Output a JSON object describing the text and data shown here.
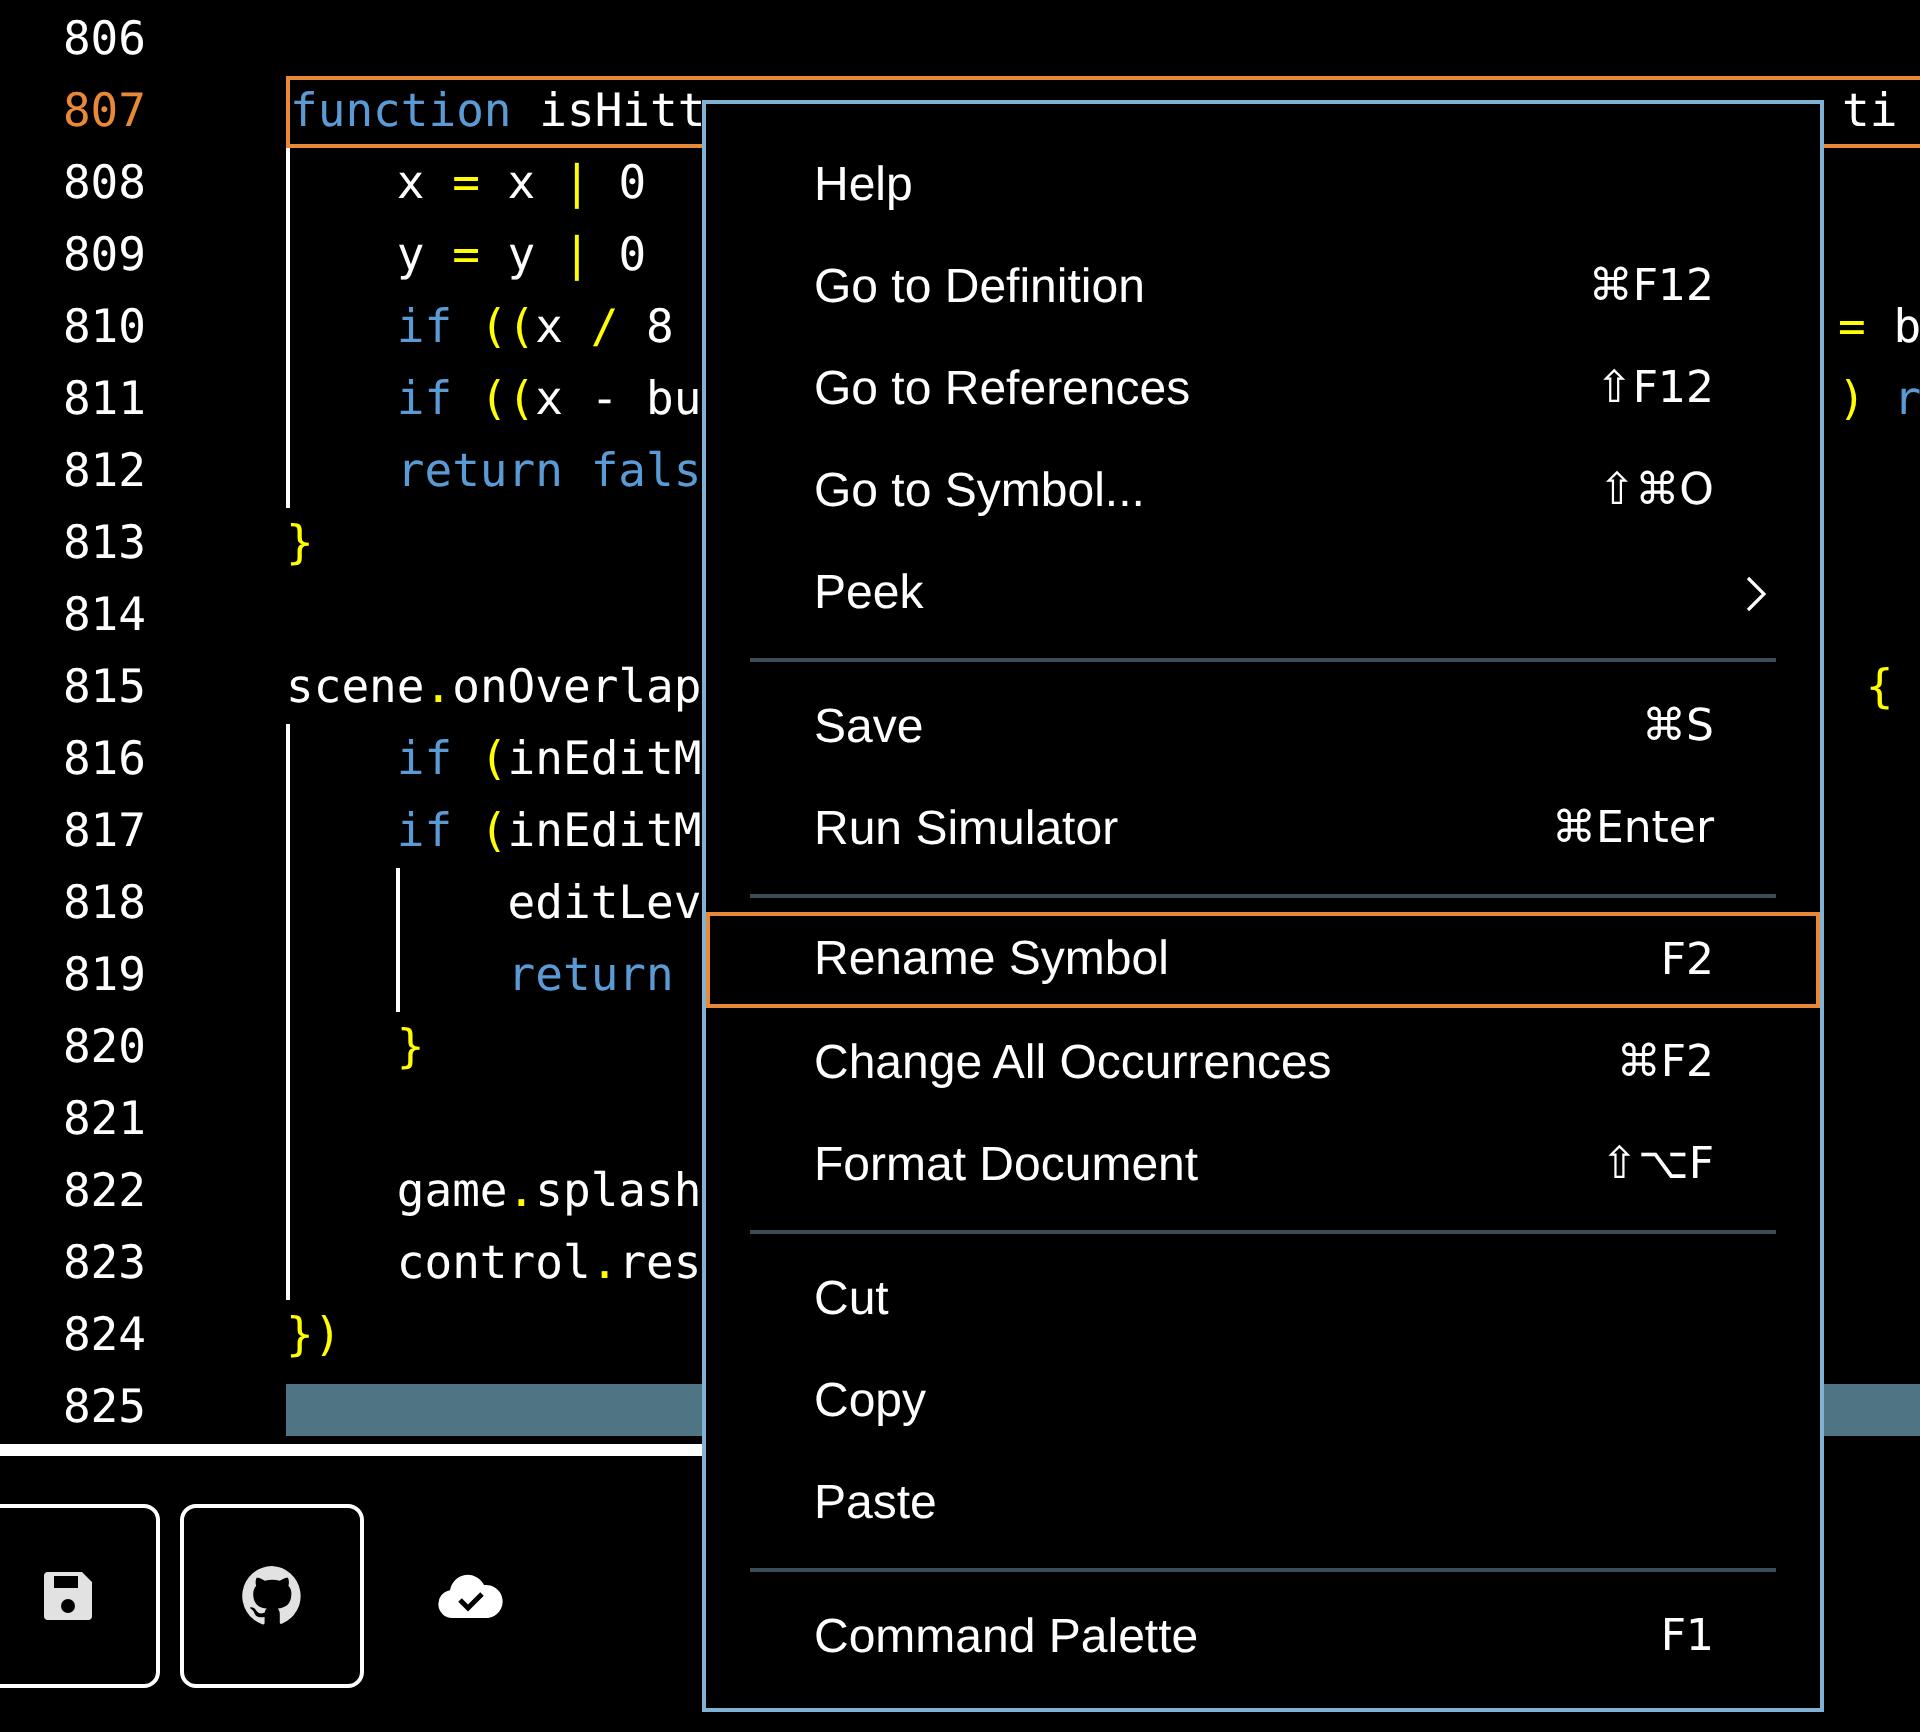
{
  "editor": {
    "lines": [
      {
        "number": "806",
        "current": false,
        "highlighted": false
      },
      {
        "number": "807",
        "current": true,
        "highlighted": false,
        "tokens": [
          {
            "text": "function",
            "kind": "keyword"
          },
          {
            "text": " isHitt",
            "kind": "plain"
          }
        ],
        "right": [
          {
            "text": "ti",
            "kind": "plain"
          }
        ]
      },
      {
        "number": "808",
        "current": false,
        "highlighted": false,
        "tokens": [
          {
            "text": "    x ",
            "kind": "plain"
          },
          {
            "text": "=",
            "kind": "punct"
          },
          {
            "text": " x ",
            "kind": "plain"
          },
          {
            "text": "|",
            "kind": "punct"
          },
          {
            "text": " 0",
            "kind": "plain"
          }
        ]
      },
      {
        "number": "809",
        "current": false,
        "highlighted": false,
        "tokens": [
          {
            "text": "    y ",
            "kind": "plain"
          },
          {
            "text": "=",
            "kind": "punct"
          },
          {
            "text": " y ",
            "kind": "plain"
          },
          {
            "text": "|",
            "kind": "punct"
          },
          {
            "text": " 0",
            "kind": "plain"
          }
        ]
      },
      {
        "number": "810",
        "current": false,
        "highlighted": false,
        "tokens": [
          {
            "text": "    if",
            "kind": "keyword"
          },
          {
            "text": " ((",
            "kind": "punct"
          },
          {
            "text": "x ",
            "kind": "plain"
          },
          {
            "text": "/",
            "kind": "punct"
          },
          {
            "text": " 8",
            "kind": "plain"
          }
        ],
        "right": [
          {
            "text": "=",
            "kind": "punct"
          },
          {
            "text": " b",
            "kind": "plain"
          }
        ]
      },
      {
        "number": "811",
        "current": false,
        "highlighted": false,
        "tokens": [
          {
            "text": "    if",
            "kind": "keyword"
          },
          {
            "text": " ((",
            "kind": "punct"
          },
          {
            "text": "x - bu",
            "kind": "plain"
          }
        ],
        "right": [
          {
            "text": ")",
            "kind": "punct"
          },
          {
            "text": " r",
            "kind": "keyword"
          }
        ]
      },
      {
        "number": "812",
        "current": false,
        "highlighted": false,
        "tokens": [
          {
            "text": "    return fals",
            "kind": "keyword"
          }
        ]
      },
      {
        "number": "813",
        "current": false,
        "highlighted": false,
        "tokens": [
          {
            "text": "}",
            "kind": "punct"
          }
        ]
      },
      {
        "number": "814",
        "current": false,
        "highlighted": false
      },
      {
        "number": "815",
        "current": false,
        "highlighted": false,
        "tokens": [
          {
            "text": "scene",
            "kind": "plain"
          },
          {
            "text": ".",
            "kind": "punct"
          },
          {
            "text": "onOverlap",
            "kind": "plain"
          }
        ],
        "right": [
          {
            "text": " {",
            "kind": "punct"
          }
        ]
      },
      {
        "number": "816",
        "current": false,
        "highlighted": false,
        "tokens": [
          {
            "text": "    if",
            "kind": "keyword"
          },
          {
            "text": " (",
            "kind": "punct"
          },
          {
            "text": "inEditM",
            "kind": "plain"
          }
        ]
      },
      {
        "number": "817",
        "current": false,
        "highlighted": false,
        "tokens": [
          {
            "text": "    if",
            "kind": "keyword"
          },
          {
            "text": " (",
            "kind": "punct"
          },
          {
            "text": "inEditM",
            "kind": "plain"
          }
        ]
      },
      {
        "number": "818",
        "current": false,
        "highlighted": false,
        "tokens": [
          {
            "text": "        editLev",
            "kind": "plain"
          }
        ]
      },
      {
        "number": "819",
        "current": false,
        "highlighted": false,
        "tokens": [
          {
            "text": "        return",
            "kind": "keyword"
          }
        ]
      },
      {
        "number": "820",
        "current": false,
        "highlighted": false,
        "tokens": [
          {
            "text": "    }",
            "kind": "punct"
          }
        ]
      },
      {
        "number": "821",
        "current": false,
        "highlighted": false
      },
      {
        "number": "822",
        "current": false,
        "highlighted": false,
        "tokens": [
          {
            "text": "    game",
            "kind": "plain"
          },
          {
            "text": ".",
            "kind": "punct"
          },
          {
            "text": "splash",
            "kind": "plain"
          }
        ]
      },
      {
        "number": "823",
        "current": false,
        "highlighted": false,
        "tokens": [
          {
            "text": "    control",
            "kind": "plain"
          },
          {
            "text": ".",
            "kind": "punct"
          },
          {
            "text": "res",
            "kind": "plain"
          }
        ]
      },
      {
        "number": "824",
        "current": false,
        "highlighted": false,
        "tokens": [
          {
            "text": "})",
            "kind": "punct"
          }
        ]
      },
      {
        "number": "825",
        "current": false,
        "highlighted": true
      }
    ]
  },
  "context_menu": {
    "groups": [
      [
        {
          "label": "Help",
          "selected": false,
          "submenu": false
        },
        {
          "label": "Go to Definition",
          "shortcut": "⌘F12",
          "selected": false,
          "submenu": false
        },
        {
          "label": "Go to References",
          "shortcut": "⇧F12",
          "selected": false,
          "submenu": false
        },
        {
          "label": "Go to Symbol...",
          "shortcut": "⇧⌘O",
          "selected": false,
          "submenu": false
        },
        {
          "label": "Peek",
          "selected": false,
          "submenu": true
        }
      ],
      [
        {
          "label": "Save",
          "shortcut": "⌘S",
          "selected": false,
          "submenu": false
        },
        {
          "label": "Run Simulator",
          "shortcut": "⌘Enter",
          "selected": false,
          "submenu": false
        }
      ],
      [
        {
          "label": "Rename Symbol",
          "shortcut": "F2",
          "selected": true,
          "submenu": false
        },
        {
          "label": "Change All Occurrences",
          "shortcut": "⌘F2",
          "selected": false,
          "submenu": false
        },
        {
          "label": "Format Document",
          "shortcut": "⇧⌥F",
          "selected": false,
          "submenu": false
        }
      ],
      [
        {
          "label": "Cut",
          "selected": false,
          "submenu": false
        },
        {
          "label": "Copy",
          "selected": false,
          "submenu": false
        },
        {
          "label": "Paste",
          "selected": false,
          "submenu": false
        }
      ],
      [
        {
          "label": "Command Palette",
          "shortcut": "F1",
          "selected": false,
          "submenu": false
        }
      ]
    ]
  }
}
